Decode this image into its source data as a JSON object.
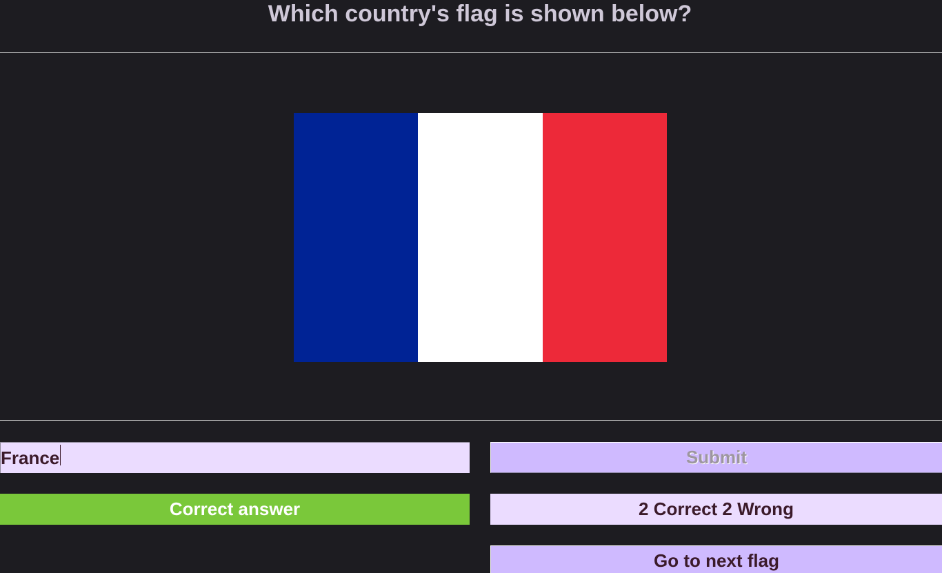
{
  "quiz": {
    "question": "Which country's flag is shown below?"
  },
  "flag": {
    "stripes": [
      {
        "color": "#002395"
      },
      {
        "color": "#ffffff"
      },
      {
        "color": "#ed2939"
      }
    ]
  },
  "answer": {
    "value": "France"
  },
  "buttons": {
    "submit_label": "Submit",
    "next_label": "Go to next flag"
  },
  "result": {
    "message": "Correct answer",
    "color": "#7ac83a"
  },
  "score": {
    "text": "2 Correct 2 Wrong"
  },
  "theme": {
    "background": "#1d1c21",
    "button_bg": "#cfbaff",
    "field_bg": "#ebdcff"
  }
}
